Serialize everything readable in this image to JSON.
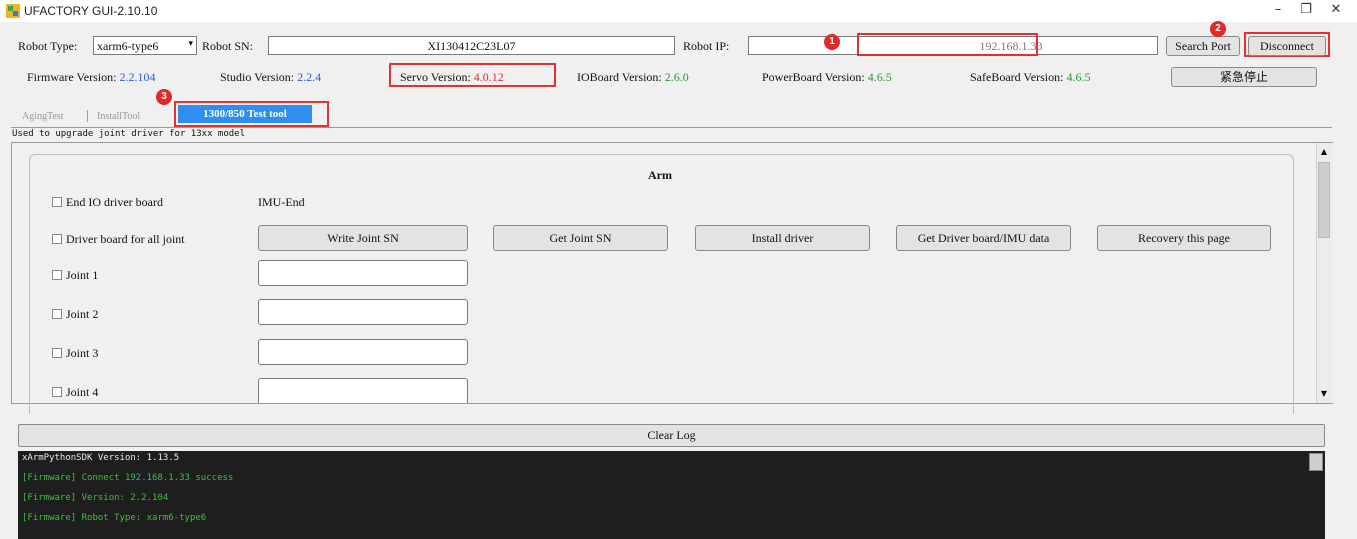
{
  "window": {
    "title": "UFACTORY GUI-2.10.10",
    "minimize": "–",
    "maximize": "❐",
    "close": "✕"
  },
  "header": {
    "robot_type_label": "Robot Type:",
    "robot_type_value": "xarm6-type6",
    "robot_sn_label": "Robot SN:",
    "robot_sn_value": "XI130412C23L07",
    "robot_ip_label": "Robot IP:",
    "robot_ip_value": "192.168.1.33",
    "search_port": "Search Port",
    "disconnect": "Disconnect",
    "emergency_stop": "紧急停止"
  },
  "versions": {
    "firmware_label": "Firmware Version:",
    "firmware_value": "2.2.104",
    "studio_label": "Studio Version:",
    "studio_value": "2.2.4",
    "servo_label": "Servo Version:",
    "servo_value": "4.0.12",
    "ioboard_label": "IOBoard Version:",
    "ioboard_value": "2.6.0",
    "powerboard_label": "PowerBoard Version:",
    "powerboard_value": "4.6.5",
    "safeboard_label": "SafeBoard Version:",
    "safeboard_value": "4.6.5"
  },
  "markers": [
    "1",
    "2",
    "3"
  ],
  "tabs": [
    "AgingTest",
    "InstallTool",
    "1300/850 Test tool"
  ],
  "tab_description": "Used to upgrade joint driver for 13xx model",
  "arm": {
    "group_title": "Arm",
    "end_io_label": "End IO driver board",
    "imu_end_label": "IMU-End",
    "driver_all_label": "Driver board for all joint",
    "buttons": [
      "Write Joint SN",
      "Get Joint SN",
      "Install driver",
      "Get Driver board/IMU data",
      "Recovery this page"
    ],
    "joints": [
      "Joint 1",
      "Joint 2",
      "Joint 3",
      "Joint 4"
    ]
  },
  "log": {
    "clear_label": "Clear Log",
    "lines": [
      "xArmPythonSDK Version: 1.13.5",
      "[Firmware] Connect 192.168.1.33 success",
      "[Firmware] Version: 2.2.104",
      "[Firmware] Robot Type: xarm6-type6"
    ]
  },
  "colors": {
    "highlight_red": "#e43030",
    "version_blue": "#2a5bd8",
    "version_green": "#2a9a2a",
    "active_tab": "#2e8ff0",
    "log_background": "#1e1e1e",
    "log_text_green": "#3fbf3f"
  }
}
